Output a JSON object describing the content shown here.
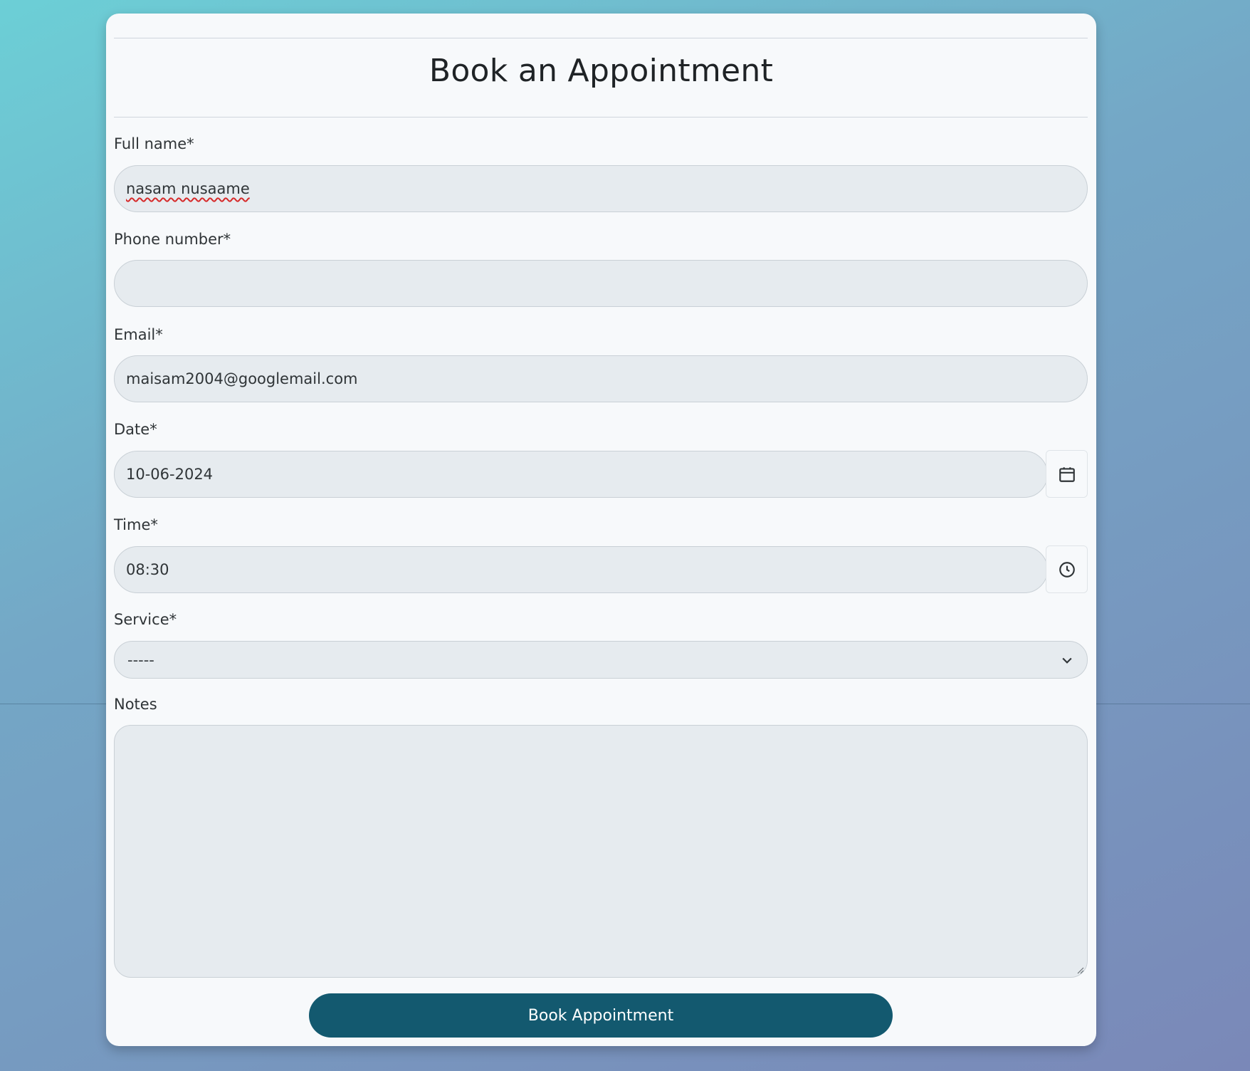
{
  "form": {
    "title": "Book an Appointment",
    "full_name": {
      "label": "Full name*",
      "value": "nasam nusaame"
    },
    "phone": {
      "label": "Phone number*",
      "value": ""
    },
    "email": {
      "label": "Email*",
      "value": "maisam2004@googlemail.com"
    },
    "date": {
      "label": "Date*",
      "value": "10-06-2024",
      "icon": "calendar-icon"
    },
    "time": {
      "label": "Time*",
      "value": "08:30",
      "icon": "clock-icon"
    },
    "service": {
      "label": "Service*",
      "selected": "-----",
      "icon": "chevron-down-icon"
    },
    "notes": {
      "label": "Notes",
      "value": ""
    },
    "submit_label": "Book Appointment"
  },
  "colors": {
    "accent": "#13596f",
    "card": "#f7f9fb",
    "field": "#e6ebef"
  }
}
